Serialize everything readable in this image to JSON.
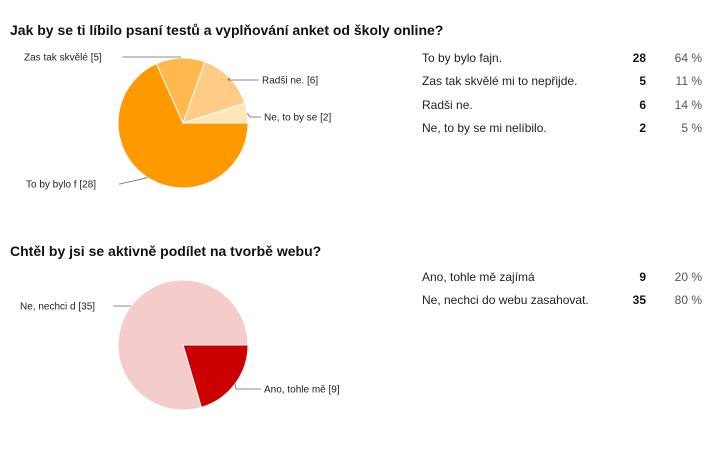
{
  "questions": [
    {
      "title": "Jak by se ti líbilo psaní testů a vyplňování anket od školy online?",
      "rows": [
        {
          "label": "To by bylo fajn.",
          "count": "28",
          "percent": "64 %"
        },
        {
          "label": "Zas tak skvělé mi to nepřijde.",
          "count": "5",
          "percent": "11 %"
        },
        {
          "label": "Radši ne.",
          "count": "6",
          "percent": "14 %"
        },
        {
          "label": "Ne, to by se mi nelíbilo.",
          "count": "2",
          "percent": "5 %"
        }
      ]
    },
    {
      "title": "Chtěl by jsi se aktivně podílet na tvorbě webu?",
      "rows": [
        {
          "label": "Ano, tohle mě zajímá",
          "count": "9",
          "percent": "20 %"
        },
        {
          "label": "Ne, nechci do webu zasahovat.",
          "count": "35",
          "percent": "80 %"
        }
      ]
    }
  ],
  "chart_data": [
    {
      "type": "pie",
      "title": "Jak by se ti líbilo psaní testů a vyplňování anket od školy online?",
      "slices": [
        {
          "label": "To by bylo f [28]",
          "value": 28,
          "color": "#ff9900"
        },
        {
          "label": "Zas tak skvělé [5]",
          "value": 5,
          "color": "#ffb84d"
        },
        {
          "label": "Radši ne. [6]",
          "value": 6,
          "color": "#ffcc88"
        },
        {
          "label": "Ne, to by se  [2]",
          "value": 2,
          "color": "#ffe5b8"
        }
      ]
    },
    {
      "type": "pie",
      "title": "Chtěl by jsi se aktivně podílet na tvorbě webu?",
      "slices": [
        {
          "label": "Ano, tohle mě [9]",
          "value": 9,
          "color": "#cc0000"
        },
        {
          "label": "Ne, nechci d [35]",
          "value": 35,
          "color": "#f4cccc"
        }
      ]
    }
  ]
}
